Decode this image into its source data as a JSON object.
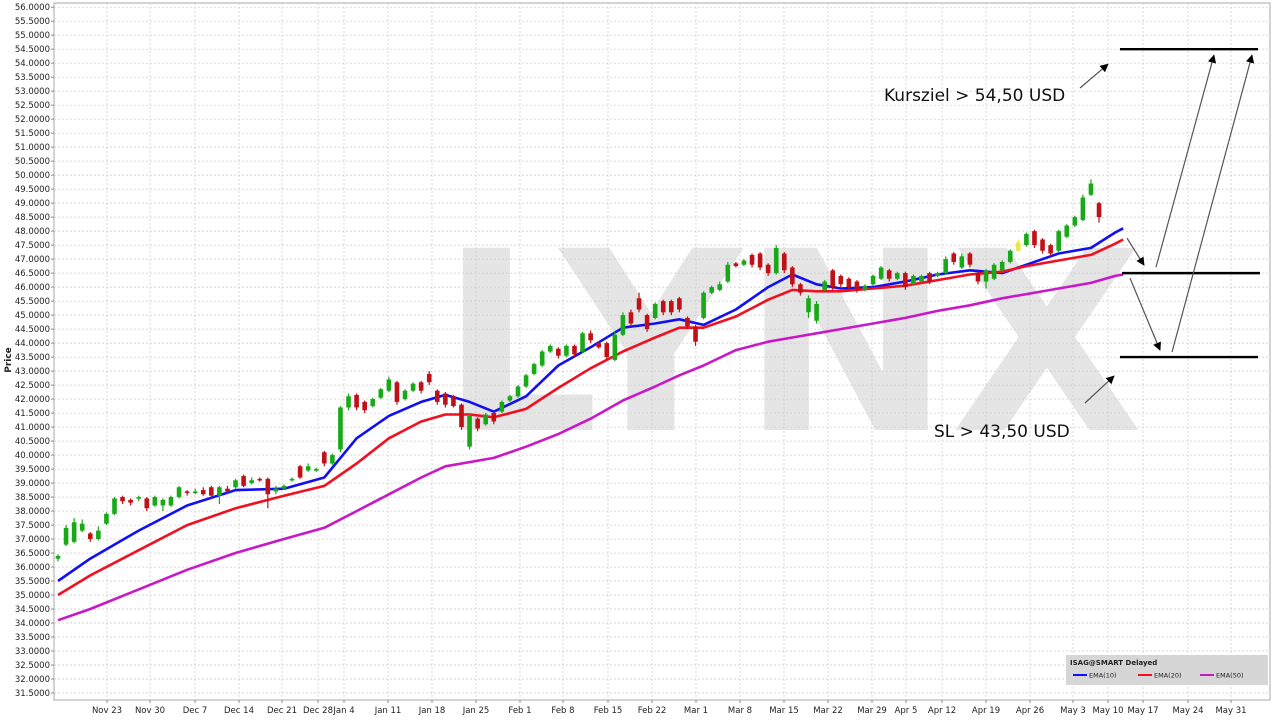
{
  "chart_data": {
    "type": "candlestick",
    "ylabel": "Price",
    "ylim": [
      31.25,
      56.15
    ],
    "y_tick_step": 0.5,
    "watermark": "LYNX",
    "x_labels": [
      "Nov 23",
      "Nov 30",
      "Dec 7",
      "Dec 14",
      "Dec 21",
      "Dec 28",
      "Jan 4",
      "Jan 11",
      "Jan 18",
      "Jan 25",
      "Feb 1",
      "Feb 8",
      "Feb 15",
      "Feb 22",
      "Mar 1",
      "Mar 8",
      "Mar 15",
      "Mar 22",
      "Mar 29",
      "Apr 5",
      "Apr 12",
      "Apr 19",
      "Apr 26",
      "May 3",
      "May 10",
      "May 17",
      "May 24",
      "May 31"
    ],
    "bars": [
      {
        "o": 36.3,
        "h": 36.45,
        "l": 36.2,
        "c": 36.4
      },
      {
        "o": 36.8,
        "h": 37.5,
        "l": 36.75,
        "c": 37.4
      },
      {
        "o": 36.9,
        "h": 37.75,
        "l": 36.85,
        "c": 37.6
      },
      {
        "o": 37.3,
        "h": 37.7,
        "l": 37.25,
        "c": 37.55
      },
      {
        "o": 37.2,
        "h": 37.25,
        "l": 36.9,
        "c": 37.0
      },
      {
        "o": 37.0,
        "h": 37.45,
        "l": 36.95,
        "c": 37.3
      },
      {
        "o": 37.55,
        "h": 37.95,
        "l": 37.5,
        "c": 37.9
      },
      {
        "o": 37.9,
        "h": 38.5,
        "l": 37.85,
        "c": 38.45
      },
      {
        "o": 38.5,
        "h": 38.55,
        "l": 38.25,
        "c": 38.35
      },
      {
        "o": 38.4,
        "h": 38.45,
        "l": 38.2,
        "c": 38.3
      },
      {
        "o": 38.45,
        "h": 38.55,
        "l": 38.35,
        "c": 38.5
      },
      {
        "o": 38.45,
        "h": 38.5,
        "l": 38.0,
        "c": 38.1
      },
      {
        "o": 38.2,
        "h": 38.55,
        "l": 38.15,
        "c": 38.5
      },
      {
        "o": 38.2,
        "h": 38.45,
        "l": 38.0,
        "c": 38.4
      },
      {
        "o": 38.2,
        "h": 38.55,
        "l": 38.15,
        "c": 38.5
      },
      {
        "o": 38.5,
        "h": 38.9,
        "l": 38.45,
        "c": 38.85
      },
      {
        "o": 38.7,
        "h": 38.75,
        "l": 38.55,
        "c": 38.65
      },
      {
        "o": 38.65,
        "h": 38.8,
        "l": 38.6,
        "c": 38.7
      },
      {
        "o": 38.75,
        "h": 38.85,
        "l": 38.55,
        "c": 38.6
      },
      {
        "o": 38.85,
        "h": 38.9,
        "l": 38.45,
        "c": 38.55
      },
      {
        "o": 38.55,
        "h": 38.9,
        "l": 38.25,
        "c": 38.85
      },
      {
        "o": 38.8,
        "h": 38.9,
        "l": 38.6,
        "c": 38.7
      },
      {
        "o": 38.85,
        "h": 39.15,
        "l": 38.8,
        "c": 39.1
      },
      {
        "o": 39.25,
        "h": 39.3,
        "l": 38.85,
        "c": 38.9
      },
      {
        "o": 39.0,
        "h": 39.2,
        "l": 38.95,
        "c": 39.1
      },
      {
        "o": 39.15,
        "h": 39.2,
        "l": 39.05,
        "c": 39.1
      },
      {
        "o": 39.15,
        "h": 39.2,
        "l": 38.1,
        "c": 38.6
      },
      {
        "o": 38.7,
        "h": 38.9,
        "l": 38.6,
        "c": 38.8
      },
      {
        "o": 38.8,
        "h": 38.95,
        "l": 38.75,
        "c": 38.9
      },
      {
        "o": 39.1,
        "h": 39.2,
        "l": 39.05,
        "c": 39.15
      },
      {
        "o": 39.6,
        "h": 39.65,
        "l": 39.15,
        "c": 39.2
      },
      {
        "o": 39.45,
        "h": 39.7,
        "l": 39.4,
        "c": 39.6
      },
      {
        "o": 39.5,
        "h": 39.55,
        "l": 39.4,
        "c": 39.5
      },
      {
        "o": 40.1,
        "h": 40.15,
        "l": 39.6,
        "c": 39.7
      },
      {
        "o": 39.7,
        "h": 40.05,
        "l": 39.65,
        "c": 40.0
      },
      {
        "o": 40.2,
        "h": 41.75,
        "l": 40.1,
        "c": 41.7
      },
      {
        "o": 41.7,
        "h": 42.2,
        "l": 41.6,
        "c": 42.1
      },
      {
        "o": 42.15,
        "h": 42.2,
        "l": 41.6,
        "c": 41.7
      },
      {
        "o": 41.9,
        "h": 41.95,
        "l": 41.5,
        "c": 41.6
      },
      {
        "o": 41.75,
        "h": 42.05,
        "l": 41.7,
        "c": 42.0
      },
      {
        "o": 42.05,
        "h": 42.4,
        "l": 42.0,
        "c": 42.35
      },
      {
        "o": 42.3,
        "h": 42.8,
        "l": 42.25,
        "c": 42.7
      },
      {
        "o": 42.6,
        "h": 42.65,
        "l": 41.8,
        "c": 41.9
      },
      {
        "o": 42.0,
        "h": 42.35,
        "l": 41.95,
        "c": 42.3
      },
      {
        "o": 42.3,
        "h": 42.6,
        "l": 42.25,
        "c": 42.55
      },
      {
        "o": 42.6,
        "h": 42.65,
        "l": 42.2,
        "c": 42.3
      },
      {
        "o": 42.9,
        "h": 43.0,
        "l": 42.5,
        "c": 42.6
      },
      {
        "o": 42.3,
        "h": 42.35,
        "l": 41.8,
        "c": 41.9
      },
      {
        "o": 42.2,
        "h": 42.25,
        "l": 41.7,
        "c": 41.8
      },
      {
        "o": 42.1,
        "h": 42.15,
        "l": 41.7,
        "c": 41.75
      },
      {
        "o": 41.8,
        "h": 41.85,
        "l": 40.9,
        "c": 41.0
      },
      {
        "o": 40.3,
        "h": 41.5,
        "l": 40.2,
        "c": 41.4
      },
      {
        "o": 41.3,
        "h": 41.35,
        "l": 40.85,
        "c": 40.95
      },
      {
        "o": 41.1,
        "h": 41.5,
        "l": 41.05,
        "c": 41.45
      },
      {
        "o": 41.5,
        "h": 41.55,
        "l": 41.1,
        "c": 41.2
      },
      {
        "o": 41.55,
        "h": 41.95,
        "l": 41.5,
        "c": 41.9
      },
      {
        "o": 41.95,
        "h": 42.15,
        "l": 41.9,
        "c": 42.1
      },
      {
        "o": 42.1,
        "h": 42.5,
        "l": 42.05,
        "c": 42.45
      },
      {
        "o": 42.45,
        "h": 42.9,
        "l": 42.4,
        "c": 42.85
      },
      {
        "o": 42.9,
        "h": 43.3,
        "l": 42.85,
        "c": 43.25
      },
      {
        "o": 43.2,
        "h": 43.75,
        "l": 43.15,
        "c": 43.7
      },
      {
        "o": 43.7,
        "h": 43.95,
        "l": 43.65,
        "c": 43.9
      },
      {
        "o": 43.8,
        "h": 43.85,
        "l": 43.45,
        "c": 43.55
      },
      {
        "o": 43.55,
        "h": 43.95,
        "l": 43.5,
        "c": 43.9
      },
      {
        "o": 43.9,
        "h": 43.95,
        "l": 43.5,
        "c": 43.6
      },
      {
        "o": 43.7,
        "h": 44.4,
        "l": 43.65,
        "c": 44.35
      },
      {
        "o": 44.35,
        "h": 44.45,
        "l": 44.0,
        "c": 44.1
      },
      {
        "o": 44.0,
        "h": 44.05,
        "l": 43.8,
        "c": 43.85
      },
      {
        "o": 44.0,
        "h": 44.05,
        "l": 43.4,
        "c": 43.5
      },
      {
        "o": 43.4,
        "h": 44.4,
        "l": 43.35,
        "c": 44.3
      },
      {
        "o": 44.3,
        "h": 45.1,
        "l": 44.25,
        "c": 45.0
      },
      {
        "o": 45.1,
        "h": 45.2,
        "l": 44.6,
        "c": 44.7
      },
      {
        "o": 45.6,
        "h": 45.8,
        "l": 45.1,
        "c": 45.2
      },
      {
        "o": 45.0,
        "h": 45.05,
        "l": 44.4,
        "c": 44.5
      },
      {
        "o": 44.9,
        "h": 45.45,
        "l": 44.85,
        "c": 45.4
      },
      {
        "o": 45.5,
        "h": 45.55,
        "l": 45.0,
        "c": 45.1
      },
      {
        "o": 45.5,
        "h": 45.55,
        "l": 45.0,
        "c": 45.1
      },
      {
        "o": 45.6,
        "h": 45.65,
        "l": 45.1,
        "c": 45.2
      },
      {
        "o": 44.9,
        "h": 44.95,
        "l": 44.5,
        "c": 44.6
      },
      {
        "o": 44.6,
        "h": 44.65,
        "l": 43.9,
        "c": 44.05
      },
      {
        "o": 44.9,
        "h": 45.85,
        "l": 44.85,
        "c": 45.8
      },
      {
        "o": 45.8,
        "h": 46.05,
        "l": 45.75,
        "c": 46.0
      },
      {
        "o": 45.9,
        "h": 46.2,
        "l": 45.85,
        "c": 46.1
      },
      {
        "o": 46.2,
        "h": 46.9,
        "l": 46.15,
        "c": 46.8
      },
      {
        "o": 46.85,
        "h": 46.9,
        "l": 46.7,
        "c": 46.75
      },
      {
        "o": 46.8,
        "h": 47.0,
        "l": 46.75,
        "c": 46.95
      },
      {
        "o": 47.15,
        "h": 47.2,
        "l": 46.7,
        "c": 46.8
      },
      {
        "o": 47.2,
        "h": 47.25,
        "l": 46.6,
        "c": 46.7
      },
      {
        "o": 46.8,
        "h": 46.85,
        "l": 46.4,
        "c": 46.5
      },
      {
        "o": 46.5,
        "h": 47.5,
        "l": 46.45,
        "c": 47.4
      },
      {
        "o": 47.2,
        "h": 47.25,
        "l": 46.5,
        "c": 46.6
      },
      {
        "o": 46.7,
        "h": 46.75,
        "l": 46.0,
        "c": 46.1
      },
      {
        "o": 46.1,
        "h": 46.15,
        "l": 45.7,
        "c": 45.8
      },
      {
        "o": 45.1,
        "h": 45.7,
        "l": 44.9,
        "c": 45.6
      },
      {
        "o": 44.8,
        "h": 45.5,
        "l": 44.7,
        "c": 45.4
      },
      {
        "o": 45.9,
        "h": 46.25,
        "l": 45.85,
        "c": 46.2
      },
      {
        "o": 46.6,
        "h": 46.65,
        "l": 45.9,
        "c": 46.0
      },
      {
        "o": 46.4,
        "h": 46.45,
        "l": 46.0,
        "c": 46.1
      },
      {
        "o": 46.3,
        "h": 46.35,
        "l": 45.9,
        "c": 46.0
      },
      {
        "o": 46.2,
        "h": 46.25,
        "l": 45.8,
        "c": 45.9
      },
      {
        "o": 45.9,
        "h": 46.1,
        "l": 45.85,
        "c": 46.05
      },
      {
        "o": 46.1,
        "h": 46.45,
        "l": 46.05,
        "c": 46.4
      },
      {
        "o": 46.3,
        "h": 46.75,
        "l": 46.25,
        "c": 46.7
      },
      {
        "o": 46.6,
        "h": 46.65,
        "l": 46.2,
        "c": 46.3
      },
      {
        "o": 46.3,
        "h": 46.55,
        "l": 46.25,
        "c": 46.5
      },
      {
        "o": 46.5,
        "h": 46.55,
        "l": 45.9,
        "c": 46.0
      },
      {
        "o": 46.1,
        "h": 46.45,
        "l": 46.05,
        "c": 46.4
      },
      {
        "o": 46.2,
        "h": 46.45,
        "l": 46.15,
        "c": 46.4
      },
      {
        "o": 46.5,
        "h": 46.55,
        "l": 46.1,
        "c": 46.2
      },
      {
        "o": 46.4,
        "h": 46.55,
        "l": 46.35,
        "c": 46.5
      },
      {
        "o": 46.5,
        "h": 47.1,
        "l": 46.45,
        "c": 47.0
      },
      {
        "o": 47.2,
        "h": 47.25,
        "l": 46.8,
        "c": 46.9
      },
      {
        "o": 46.7,
        "h": 47.2,
        "l": 46.65,
        "c": 47.1
      },
      {
        "o": 47.2,
        "h": 47.25,
        "l": 46.7,
        "c": 46.8
      },
      {
        "o": 46.5,
        "h": 46.55,
        "l": 46.1,
        "c": 46.2
      },
      {
        "o": 46.2,
        "h": 46.65,
        "l": 45.95,
        "c": 46.6
      },
      {
        "o": 46.3,
        "h": 46.85,
        "l": 46.25,
        "c": 46.8
      },
      {
        "o": 46.6,
        "h": 46.95,
        "l": 46.55,
        "c": 46.9
      },
      {
        "o": 46.9,
        "h": 47.35,
        "l": 46.85,
        "c": 47.3
      },
      {
        "o": 47.3,
        "h": 47.7,
        "l": 47.25,
        "c": 47.6,
        "color": "#e8e84a"
      },
      {
        "o": 47.5,
        "h": 47.95,
        "l": 47.45,
        "c": 47.9
      },
      {
        "o": 48.0,
        "h": 48.05,
        "l": 47.4,
        "c": 47.5
      },
      {
        "o": 47.7,
        "h": 47.75,
        "l": 47.2,
        "c": 47.3
      },
      {
        "o": 47.5,
        "h": 47.55,
        "l": 47.1,
        "c": 47.2
      },
      {
        "o": 47.3,
        "h": 48.05,
        "l": 47.25,
        "c": 48.0
      },
      {
        "o": 47.8,
        "h": 48.25,
        "l": 47.75,
        "c": 48.2
      },
      {
        "o": 48.2,
        "h": 48.55,
        "l": 48.15,
        "c": 48.5
      },
      {
        "o": 48.4,
        "h": 49.3,
        "l": 48.35,
        "c": 49.2
      },
      {
        "o": 49.3,
        "h": 49.85,
        "l": 49.25,
        "c": 49.7
      },
      {
        "o": 49.0,
        "h": 49.05,
        "l": 48.3,
        "c": 48.5
      }
    ],
    "series": [
      {
        "name": "EMA(10)",
        "color": "#1010f0",
        "pts": [
          [
            0,
            35.5
          ],
          [
            4,
            36.3
          ],
          [
            10,
            37.3
          ],
          [
            16,
            38.2
          ],
          [
            22,
            38.75
          ],
          [
            28,
            38.8
          ],
          [
            33,
            39.2
          ],
          [
            37,
            40.6
          ],
          [
            41,
            41.4
          ],
          [
            45,
            41.9
          ],
          [
            48,
            42.15
          ],
          [
            51,
            41.9
          ],
          [
            54,
            41.55
          ],
          [
            58,
            42.1
          ],
          [
            62,
            43.2
          ],
          [
            66,
            43.85
          ],
          [
            70,
            44.55
          ],
          [
            74,
            44.7
          ],
          [
            77,
            44.85
          ],
          [
            80,
            44.65
          ],
          [
            84,
            45.2
          ],
          [
            88,
            46.0
          ],
          [
            91,
            46.45
          ],
          [
            94,
            46.1
          ],
          [
            97,
            45.95
          ],
          [
            101,
            46.0
          ],
          [
            105,
            46.2
          ],
          [
            109,
            46.45
          ],
          [
            113,
            46.6
          ],
          [
            117,
            46.5
          ],
          [
            120,
            46.8
          ],
          [
            124,
            47.2
          ],
          [
            128,
            47.4
          ],
          [
            131,
            47.95
          ],
          [
            132,
            48.1
          ]
        ]
      },
      {
        "name": "EMA(20)",
        "color": "#f01020",
        "pts": [
          [
            0,
            35.0
          ],
          [
            4,
            35.7
          ],
          [
            10,
            36.6
          ],
          [
            16,
            37.5
          ],
          [
            22,
            38.1
          ],
          [
            28,
            38.55
          ],
          [
            33,
            38.9
          ],
          [
            37,
            39.7
          ],
          [
            41,
            40.6
          ],
          [
            45,
            41.2
          ],
          [
            48,
            41.45
          ],
          [
            51,
            41.45
          ],
          [
            54,
            41.35
          ],
          [
            58,
            41.65
          ],
          [
            62,
            42.4
          ],
          [
            66,
            43.1
          ],
          [
            70,
            43.7
          ],
          [
            74,
            44.2
          ],
          [
            77,
            44.55
          ],
          [
            80,
            44.55
          ],
          [
            84,
            44.95
          ],
          [
            88,
            45.55
          ],
          [
            91,
            45.9
          ],
          [
            94,
            45.85
          ],
          [
            97,
            45.85
          ],
          [
            101,
            45.95
          ],
          [
            105,
            46.05
          ],
          [
            109,
            46.25
          ],
          [
            113,
            46.45
          ],
          [
            117,
            46.55
          ],
          [
            120,
            46.75
          ],
          [
            124,
            46.95
          ],
          [
            128,
            47.15
          ],
          [
            131,
            47.55
          ],
          [
            132,
            47.7
          ]
        ]
      },
      {
        "name": "EMA(50)",
        "color": "#c818c8",
        "pts": [
          [
            0,
            34.1
          ],
          [
            4,
            34.5
          ],
          [
            10,
            35.2
          ],
          [
            16,
            35.9
          ],
          [
            22,
            36.5
          ],
          [
            28,
            37.0
          ],
          [
            33,
            37.4
          ],
          [
            37,
            38.0
          ],
          [
            41,
            38.6
          ],
          [
            45,
            39.2
          ],
          [
            48,
            39.6
          ],
          [
            51,
            39.75
          ],
          [
            54,
            39.9
          ],
          [
            58,
            40.3
          ],
          [
            62,
            40.75
          ],
          [
            66,
            41.3
          ],
          [
            70,
            41.95
          ],
          [
            74,
            42.45
          ],
          [
            77,
            42.85
          ],
          [
            80,
            43.2
          ],
          [
            84,
            43.75
          ],
          [
            88,
            44.05
          ],
          [
            91,
            44.2
          ],
          [
            94,
            44.35
          ],
          [
            97,
            44.5
          ],
          [
            101,
            44.7
          ],
          [
            105,
            44.9
          ],
          [
            109,
            45.15
          ],
          [
            113,
            45.35
          ],
          [
            117,
            45.6
          ],
          [
            120,
            45.75
          ],
          [
            124,
            45.95
          ],
          [
            128,
            46.15
          ],
          [
            131,
            46.4
          ],
          [
            132,
            46.45
          ]
        ]
      }
    ],
    "levels": [
      54.5,
      46.5,
      43.5
    ],
    "annotations": {
      "target": "Kursziel > 54,50 USD",
      "stoploss": "SL > 43,50 USD"
    },
    "legend": {
      "title": "ISAG@SMART Delayed",
      "items": [
        "EMA(10)",
        "EMA(20)",
        "EMA(50)"
      ]
    }
  }
}
